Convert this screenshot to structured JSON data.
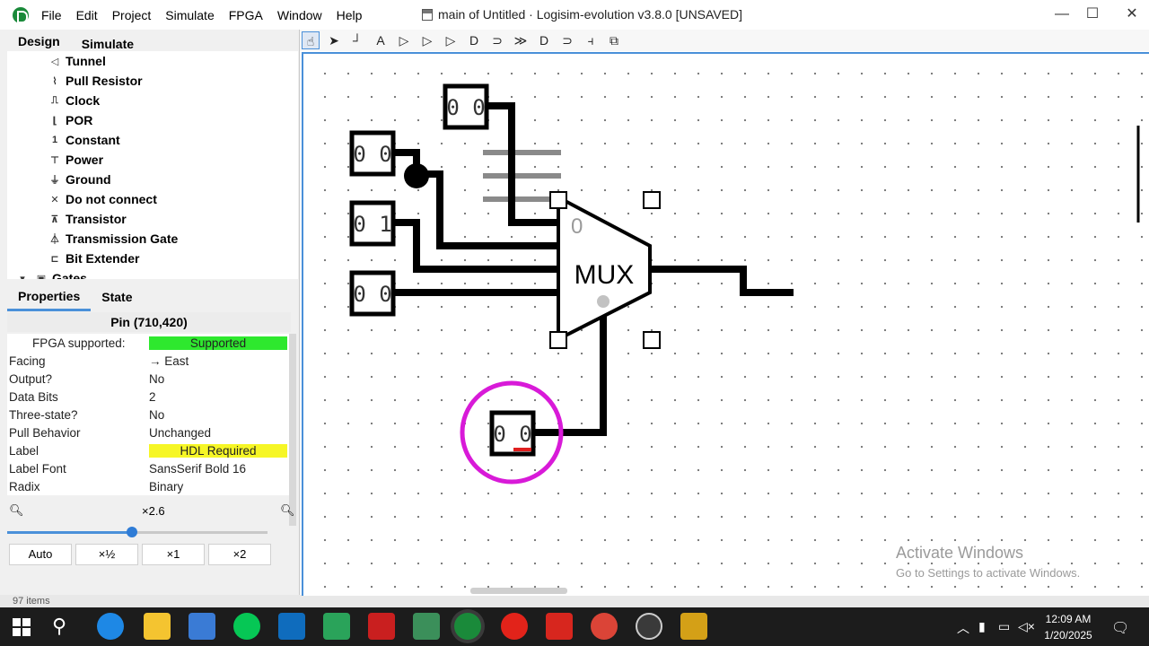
{
  "menu": [
    "File",
    "Edit",
    "Project",
    "Simulate",
    "FPGA",
    "Window",
    "Help"
  ],
  "window_title": "main of Untitled · Logisim-evolution v3.8.0 [UNSAVED]",
  "window_controls": {
    "minimize": "—",
    "maximize": "☐",
    "close": "✕"
  },
  "left_tabs": {
    "design": "Design",
    "simulate": "Simulate"
  },
  "tree_toolbar_icons": [
    "add-icon",
    "vhdl-icon",
    "up-icon",
    "down-icon",
    "edit-icon",
    "delete-icon"
  ],
  "tree_items": [
    {
      "label": "Tunnel",
      "icon": "tunnel-icon",
      "glyph": "◁"
    },
    {
      "label": "Pull Resistor",
      "icon": "pull-resistor-icon",
      "glyph": "⌇"
    },
    {
      "label": "Clock",
      "icon": "clock-icon",
      "glyph": "⎍"
    },
    {
      "label": "POR",
      "icon": "por-icon",
      "glyph": "⌊"
    },
    {
      "label": "Constant",
      "icon": "constant-icon",
      "glyph": "1"
    },
    {
      "label": "Power",
      "icon": "power-icon",
      "glyph": "⊤"
    },
    {
      "label": "Ground",
      "icon": "ground-icon",
      "glyph": "⏚"
    },
    {
      "label": "Do not connect",
      "icon": "do-not-connect-icon",
      "glyph": "✕"
    },
    {
      "label": "Transistor",
      "icon": "transistor-icon",
      "glyph": "⊼"
    },
    {
      "label": "Transmission Gate",
      "icon": "transmission-gate-icon",
      "glyph": "⏃"
    },
    {
      "label": "Bit Extender",
      "icon": "bit-extender-icon",
      "glyph": "⊏"
    }
  ],
  "tree_group": "Gates",
  "props_tabs": {
    "properties": "Properties",
    "state": "State"
  },
  "props_header": "Pin (710,420)",
  "properties": [
    {
      "key": "FPGA supported:",
      "value": "Supported",
      "style": "green"
    },
    {
      "key": "Facing",
      "value": "→ East",
      "style": ""
    },
    {
      "key": "Output?",
      "value": "No",
      "style": ""
    },
    {
      "key": "Data Bits",
      "value": "2",
      "style": ""
    },
    {
      "key": "Three-state?",
      "value": "No",
      "style": ""
    },
    {
      "key": "Pull Behavior",
      "value": "Unchanged",
      "style": ""
    },
    {
      "key": "Label",
      "value": "HDL Required",
      "style": "yellow"
    },
    {
      "key": "Label Font",
      "value": "SansSerif Bold 16",
      "style": ""
    },
    {
      "key": "Radix",
      "value": "Binary",
      "style": ""
    }
  ],
  "zoom": {
    "label": "×2.6",
    "buttons": [
      "Auto",
      "×½",
      "×1",
      "×2"
    ]
  },
  "status": "97 items",
  "toolbar_icons": [
    "poke-tool-icon",
    "select-tool-icon",
    "wiring-tool-icon",
    "text-tool-icon",
    "input-pin-icon",
    "output-pin-icon",
    "not-gate-icon",
    "and-gate-icon",
    "or-gate-icon",
    "xor-gate-icon",
    "nand-gate-icon",
    "nor-gate-icon",
    "splitter-icon",
    "probe-icon"
  ],
  "circuit": {
    "pin_a": "0 0",
    "pin_b": "0 0",
    "pin_c": "0 1",
    "pin_d": "0 0",
    "pin_sel": "0 0",
    "mux_label": "MUX",
    "mux_input0": "0"
  },
  "watermark": {
    "title": "Activate Windows",
    "subtitle": "Go to Settings to activate Windows."
  },
  "clock": {
    "time": "12:09 AM",
    "date": "1/20/2025"
  },
  "colors": {
    "accent": "#4a90d9",
    "supported": "#2ee82e",
    "hdl_required": "#f6f626",
    "select_ring": "#d81ad8",
    "wire": "#000000"
  }
}
